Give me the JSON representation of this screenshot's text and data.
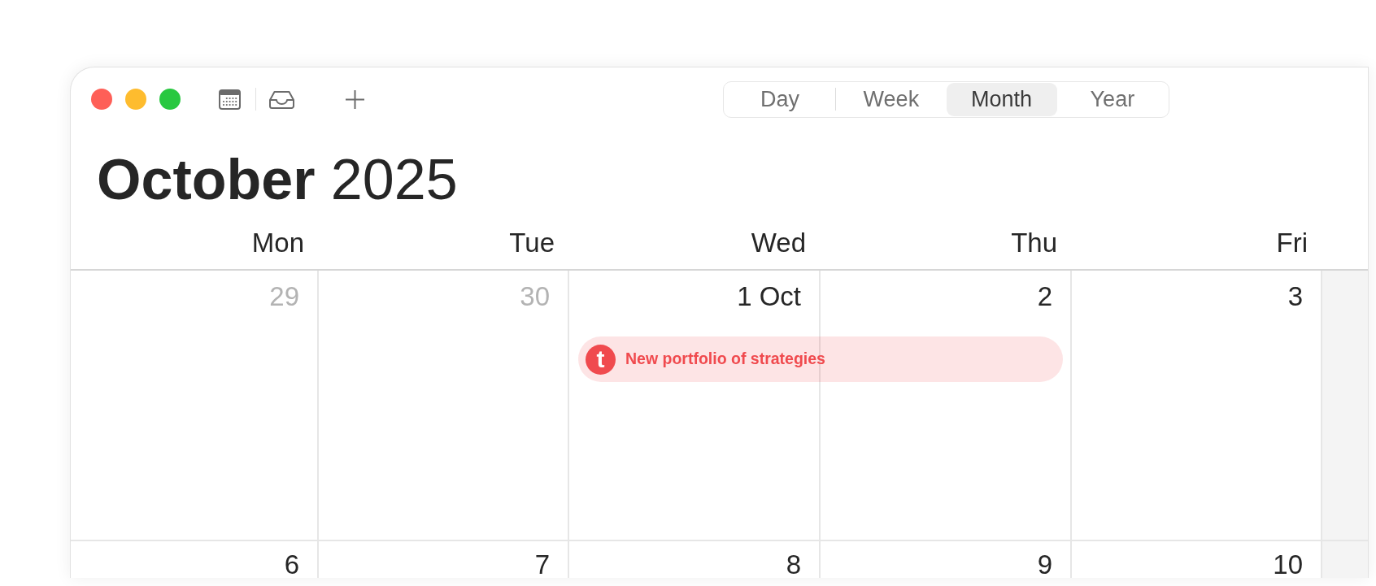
{
  "toolbar": {
    "views": [
      {
        "label": "Day",
        "selected": false
      },
      {
        "label": "Week",
        "selected": false
      },
      {
        "label": "Month",
        "selected": true
      },
      {
        "label": "Year",
        "selected": false
      }
    ]
  },
  "title": "**October** 2025",
  "weekdays": [
    "Mon",
    "Tue",
    "Wed",
    "Thu",
    "Fri"
  ],
  "weeks": [
    {
      "days": [
        {
          "label": "29",
          "in_month": false
        },
        {
          "label": "30",
          "in_month": false
        },
        {
          "label": "1 Oct",
          "in_month": true,
          "events": [
            {
              "title": "New portfolio of strategies",
              "app_letter": "t",
              "color": "#f04a4e",
              "continues_next_day": true
            }
          ]
        },
        {
          "label": "2",
          "in_month": true
        },
        {
          "label": "3",
          "in_month": true
        }
      ]
    },
    {
      "days": [
        {
          "label": "6",
          "in_month": true
        },
        {
          "label": "7",
          "in_month": true
        },
        {
          "label": "8",
          "in_month": true
        },
        {
          "label": "9",
          "in_month": true
        },
        {
          "label": "10",
          "in_month": true
        }
      ]
    }
  ]
}
